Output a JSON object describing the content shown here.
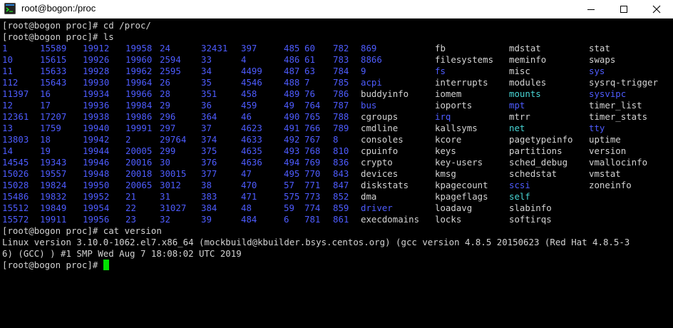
{
  "window": {
    "title": "root@bogon:/proc"
  },
  "terminal": {
    "lines": [
      "[root@bogon proc]# cd /proc/",
      "[root@bogon proc]# ls"
    ],
    "ls_rows": [
      [
        [
          "1",
          "blue"
        ],
        [
          "15589",
          "blue"
        ],
        [
          "19912",
          "blue"
        ],
        [
          "19958",
          "blue"
        ],
        [
          "24",
          "blue"
        ],
        [
          "32431",
          "blue"
        ],
        [
          "397",
          "blue"
        ],
        [
          "485",
          "blue"
        ],
        [
          "60",
          "blue"
        ],
        [
          "782",
          "blue"
        ],
        [
          "869",
          "blue"
        ],
        [
          "fb",
          "def"
        ],
        [
          "mdstat",
          "def"
        ],
        [
          "stat",
          "def"
        ]
      ],
      [
        [
          "10",
          "blue"
        ],
        [
          "15615",
          "blue"
        ],
        [
          "19926",
          "blue"
        ],
        [
          "19960",
          "blue"
        ],
        [
          "2594",
          "blue"
        ],
        [
          "33",
          "blue"
        ],
        [
          "4",
          "blue"
        ],
        [
          "486",
          "blue"
        ],
        [
          "61",
          "blue"
        ],
        [
          "783",
          "blue"
        ],
        [
          "8866",
          "blue"
        ],
        [
          "filesystems",
          "def"
        ],
        [
          "meminfo",
          "def"
        ],
        [
          "swaps",
          "def"
        ]
      ],
      [
        [
          "11",
          "blue"
        ],
        [
          "15633",
          "blue"
        ],
        [
          "19928",
          "blue"
        ],
        [
          "19962",
          "blue"
        ],
        [
          "2595",
          "blue"
        ],
        [
          "34",
          "blue"
        ],
        [
          "4499",
          "blue"
        ],
        [
          "487",
          "blue"
        ],
        [
          "63",
          "blue"
        ],
        [
          "784",
          "blue"
        ],
        [
          "9",
          "blue"
        ],
        [
          "fs",
          "blue"
        ],
        [
          "misc",
          "def"
        ],
        [
          "sys",
          "blue"
        ]
      ],
      [
        [
          "112",
          "blue"
        ],
        [
          "15643",
          "blue"
        ],
        [
          "19930",
          "blue"
        ],
        [
          "19964",
          "blue"
        ],
        [
          "26",
          "blue"
        ],
        [
          "35",
          "blue"
        ],
        [
          "4546",
          "blue"
        ],
        [
          "488",
          "blue"
        ],
        [
          "7",
          "blue"
        ],
        [
          "785",
          "blue"
        ],
        [
          "acpi",
          "blue"
        ],
        [
          "interrupts",
          "def"
        ],
        [
          "modules",
          "def"
        ],
        [
          "sysrq-trigger",
          "def"
        ]
      ],
      [
        [
          "11397",
          "blue"
        ],
        [
          "16",
          "blue"
        ],
        [
          "19934",
          "blue"
        ],
        [
          "19966",
          "blue"
        ],
        [
          "28",
          "blue"
        ],
        [
          "351",
          "blue"
        ],
        [
          "458",
          "blue"
        ],
        [
          "489",
          "blue"
        ],
        [
          "76",
          "blue"
        ],
        [
          "786",
          "blue"
        ],
        [
          "buddyinfo",
          "def"
        ],
        [
          "iomem",
          "def"
        ],
        [
          "mounts",
          "cyan"
        ],
        [
          "sysvipc",
          "blue"
        ]
      ],
      [
        [
          "12",
          "blue"
        ],
        [
          "17",
          "blue"
        ],
        [
          "19936",
          "blue"
        ],
        [
          "19984",
          "blue"
        ],
        [
          "29",
          "blue"
        ],
        [
          "36",
          "blue"
        ],
        [
          "459",
          "blue"
        ],
        [
          "49",
          "blue"
        ],
        [
          "764",
          "blue"
        ],
        [
          "787",
          "blue"
        ],
        [
          "bus",
          "blue"
        ],
        [
          "ioports",
          "def"
        ],
        [
          "mpt",
          "blue"
        ],
        [
          "timer_list",
          "def"
        ]
      ],
      [
        [
          "12361",
          "blue"
        ],
        [
          "17207",
          "blue"
        ],
        [
          "19938",
          "blue"
        ],
        [
          "19986",
          "blue"
        ],
        [
          "296",
          "blue"
        ],
        [
          "364",
          "blue"
        ],
        [
          "46",
          "blue"
        ],
        [
          "490",
          "blue"
        ],
        [
          "765",
          "blue"
        ],
        [
          "788",
          "blue"
        ],
        [
          "cgroups",
          "def"
        ],
        [
          "irq",
          "blue"
        ],
        [
          "mtrr",
          "def"
        ],
        [
          "timer_stats",
          "def"
        ]
      ],
      [
        [
          "13",
          "blue"
        ],
        [
          "1759",
          "blue"
        ],
        [
          "19940",
          "blue"
        ],
        [
          "19991",
          "blue"
        ],
        [
          "297",
          "blue"
        ],
        [
          "37",
          "blue"
        ],
        [
          "4623",
          "blue"
        ],
        [
          "491",
          "blue"
        ],
        [
          "766",
          "blue"
        ],
        [
          "789",
          "blue"
        ],
        [
          "cmdline",
          "def"
        ],
        [
          "kallsyms",
          "def"
        ],
        [
          "net",
          "cyan"
        ],
        [
          "tty",
          "blue"
        ]
      ],
      [
        [
          "13803",
          "blue"
        ],
        [
          "18",
          "blue"
        ],
        [
          "19942",
          "blue"
        ],
        [
          "2",
          "blue"
        ],
        [
          "29764",
          "blue"
        ],
        [
          "374",
          "blue"
        ],
        [
          "4633",
          "blue"
        ],
        [
          "492",
          "blue"
        ],
        [
          "767",
          "blue"
        ],
        [
          "8",
          "blue"
        ],
        [
          "consoles",
          "def"
        ],
        [
          "kcore",
          "def"
        ],
        [
          "pagetypeinfo",
          "def"
        ],
        [
          "uptime",
          "def"
        ]
      ],
      [
        [
          "14",
          "blue"
        ],
        [
          "19",
          "blue"
        ],
        [
          "19944",
          "blue"
        ],
        [
          "20005",
          "blue"
        ],
        [
          "299",
          "blue"
        ],
        [
          "375",
          "blue"
        ],
        [
          "4635",
          "blue"
        ],
        [
          "493",
          "blue"
        ],
        [
          "768",
          "blue"
        ],
        [
          "810",
          "blue"
        ],
        [
          "cpuinfo",
          "def"
        ],
        [
          "keys",
          "def"
        ],
        [
          "partitions",
          "def"
        ],
        [
          "version",
          "def"
        ]
      ],
      [
        [
          "14545",
          "blue"
        ],
        [
          "19343",
          "blue"
        ],
        [
          "19946",
          "blue"
        ],
        [
          "20016",
          "blue"
        ],
        [
          "30",
          "blue"
        ],
        [
          "376",
          "blue"
        ],
        [
          "4636",
          "blue"
        ],
        [
          "494",
          "blue"
        ],
        [
          "769",
          "blue"
        ],
        [
          "836",
          "blue"
        ],
        [
          "crypto",
          "def"
        ],
        [
          "key-users",
          "def"
        ],
        [
          "sched_debug",
          "def"
        ],
        [
          "vmallocinfo",
          "def"
        ]
      ],
      [
        [
          "15026",
          "blue"
        ],
        [
          "19557",
          "blue"
        ],
        [
          "19948",
          "blue"
        ],
        [
          "20018",
          "blue"
        ],
        [
          "30015",
          "blue"
        ],
        [
          "377",
          "blue"
        ],
        [
          "47",
          "blue"
        ],
        [
          "495",
          "blue"
        ],
        [
          "770",
          "blue"
        ],
        [
          "843",
          "blue"
        ],
        [
          "devices",
          "def"
        ],
        [
          "kmsg",
          "def"
        ],
        [
          "schedstat",
          "def"
        ],
        [
          "vmstat",
          "def"
        ]
      ],
      [
        [
          "15028",
          "blue"
        ],
        [
          "19824",
          "blue"
        ],
        [
          "19950",
          "blue"
        ],
        [
          "20065",
          "blue"
        ],
        [
          "3012",
          "blue"
        ],
        [
          "38",
          "blue"
        ],
        [
          "470",
          "blue"
        ],
        [
          "57",
          "blue"
        ],
        [
          "771",
          "blue"
        ],
        [
          "847",
          "blue"
        ],
        [
          "diskstats",
          "def"
        ],
        [
          "kpagecount",
          "def"
        ],
        [
          "scsi",
          "blue"
        ],
        [
          "zoneinfo",
          "def"
        ]
      ],
      [
        [
          "15486",
          "blue"
        ],
        [
          "19832",
          "blue"
        ],
        [
          "19952",
          "blue"
        ],
        [
          "21",
          "blue"
        ],
        [
          "31",
          "blue"
        ],
        [
          "383",
          "blue"
        ],
        [
          "471",
          "blue"
        ],
        [
          "575",
          "blue"
        ],
        [
          "773",
          "blue"
        ],
        [
          "852",
          "blue"
        ],
        [
          "dma",
          "def"
        ],
        [
          "kpageflags",
          "def"
        ],
        [
          "self",
          "cyan"
        ],
        [
          "",
          ""
        ]
      ],
      [
        [
          "15512",
          "blue"
        ],
        [
          "19849",
          "blue"
        ],
        [
          "19954",
          "blue"
        ],
        [
          "22",
          "blue"
        ],
        [
          "31027",
          "blue"
        ],
        [
          "384",
          "blue"
        ],
        [
          "48",
          "blue"
        ],
        [
          "59",
          "blue"
        ],
        [
          "774",
          "blue"
        ],
        [
          "859",
          "blue"
        ],
        [
          "driver",
          "blue"
        ],
        [
          "loadavg",
          "def"
        ],
        [
          "slabinfo",
          "def"
        ],
        [
          "",
          ""
        ]
      ],
      [
        [
          "15572",
          "blue"
        ],
        [
          "19911",
          "blue"
        ],
        [
          "19956",
          "blue"
        ],
        [
          "23",
          "blue"
        ],
        [
          "32",
          "blue"
        ],
        [
          "39",
          "blue"
        ],
        [
          "484",
          "blue"
        ],
        [
          "6",
          "blue"
        ],
        [
          "781",
          "blue"
        ],
        [
          "861",
          "blue"
        ],
        [
          "execdomains",
          "def"
        ],
        [
          "locks",
          "def"
        ],
        [
          "softirqs",
          "def"
        ],
        [
          "",
          ""
        ]
      ]
    ],
    "after_lines": [
      "[root@bogon proc]# cat version",
      "Linux version 3.10.0-1062.el7.x86_64 (mockbuild@kbuilder.bsys.centos.org) (gcc version 4.8.5 20150623 (Red Hat 4.8.5-3",
      "6) (GCC) ) #1 SMP Wed Aug 7 18:08:02 UTC 2019"
    ],
    "prompt": "[root@bogon proc]# "
  },
  "colors": {
    "background": "#000000",
    "text": "#d3d3d3",
    "directory": "#4e5cff",
    "link": "#48d5d5",
    "cursor": "#00e000"
  },
  "icons": {
    "app": "terminal-app-icon",
    "minimize": "minimize-icon",
    "maximize": "maximize-icon",
    "close": "close-icon"
  }
}
